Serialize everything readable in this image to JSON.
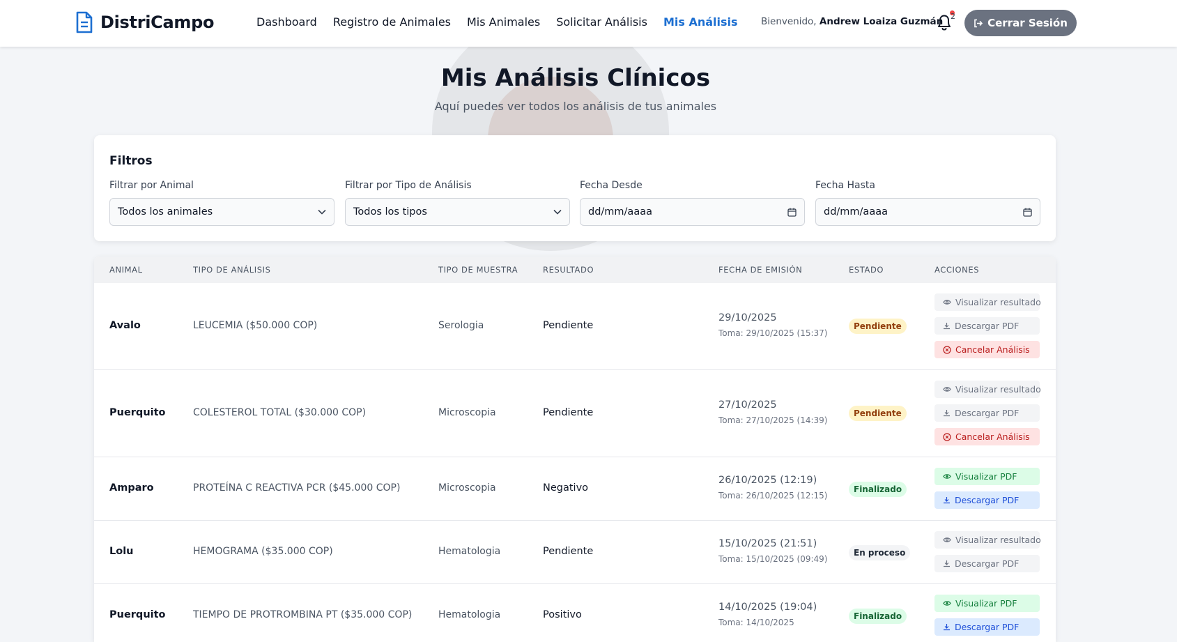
{
  "app": {
    "brand": "DistriCampo"
  },
  "nav": {
    "items": [
      "Dashboard",
      "Registro de Animales",
      "Mis Animales",
      "Solicitar Análisis",
      "Mis Análisis"
    ],
    "active": "Mis Análisis"
  },
  "header": {
    "welcome_prefix": "Bienvenido,",
    "user_name": "Andrew Loaiza Guzmán",
    "notification_count": "2",
    "logout_label": "Cerrar Sesión"
  },
  "page": {
    "title": "Mis Análisis Clínicos",
    "subtitle": "Aquí puedes ver todos los análisis de tus animales"
  },
  "filters": {
    "title": "Filtros",
    "animal": {
      "label": "Filtrar por Animal",
      "value": "Todos los animales"
    },
    "tipo": {
      "label": "Filtrar por Tipo de Análisis",
      "value": "Todos los tipos"
    },
    "desde": {
      "label": "Fecha Desde",
      "placeholder": "dd/mm/aaaa"
    },
    "hasta": {
      "label": "Fecha Hasta",
      "placeholder": "dd/mm/aaaa"
    }
  },
  "table": {
    "headers": [
      "ANIMAL",
      "TIPO DE ANÁLISIS",
      "TIPO DE MUESTRA",
      "RESULTADO",
      "FECHA DE EMISIÓN",
      "ESTADO",
      "ACCIONES"
    ],
    "rows": [
      {
        "animal": "Avalo",
        "tipo": "LEUCEMIA ($50.000 COP)",
        "muestra": "Serologia",
        "resultado": "Pendiente",
        "fecha": "29/10/2025",
        "toma": "Toma: 29/10/2025 (15:37)",
        "estado": "Pendiente",
        "actions": [
          "Visualizar resultado",
          "Descargar PDF",
          "Cancelar Análisis"
        ]
      },
      {
        "animal": "Puerquito",
        "tipo": "COLESTEROL TOTAL ($30.000 COP)",
        "muestra": "Microscopia",
        "resultado": "Pendiente",
        "fecha": "27/10/2025",
        "toma": "Toma: 27/10/2025 (14:39)",
        "estado": "Pendiente",
        "actions": [
          "Visualizar resultado",
          "Descargar PDF",
          "Cancelar Análisis"
        ]
      },
      {
        "animal": "Amparo",
        "tipo": "PROTEÍNA C REACTIVA PCR ($45.000 COP)",
        "muestra": "Microscopia",
        "resultado": "Negativo",
        "fecha": "26/10/2025 (12:19)",
        "toma": "Toma: 26/10/2025 (12:15)",
        "estado": "Finalizado",
        "actions": [
          "Visualizar PDF",
          "Descargar PDF"
        ]
      },
      {
        "animal": "Lolu",
        "tipo": "HEMOGRAMA ($35.000 COP)",
        "muestra": "Hematologia",
        "resultado": "Pendiente",
        "fecha": "15/10/2025 (21:51)",
        "toma": "Toma: 15/10/2025 (09:49)",
        "estado": "En proceso",
        "actions": [
          "Visualizar resultado",
          "Descargar PDF"
        ]
      },
      {
        "animal": "Puerquito",
        "tipo": "TIEMPO DE PROTROMBINA PT ($35.000 COP)",
        "muestra": "Hematologia",
        "resultado": "Positivo",
        "fecha": "14/10/2025 (19:04)",
        "toma": "Toma: 14/10/2025",
        "estado": "Finalizado",
        "actions": [
          "Visualizar PDF",
          "Descargar PDF"
        ]
      }
    ]
  },
  "colors": {
    "accent": "#1d6fd1",
    "logout_bg": "#6b7280",
    "pending_bg": "#fef3c7",
    "finished_bg": "#dcfce7",
    "cancel_bg": "#fee2e2"
  }
}
